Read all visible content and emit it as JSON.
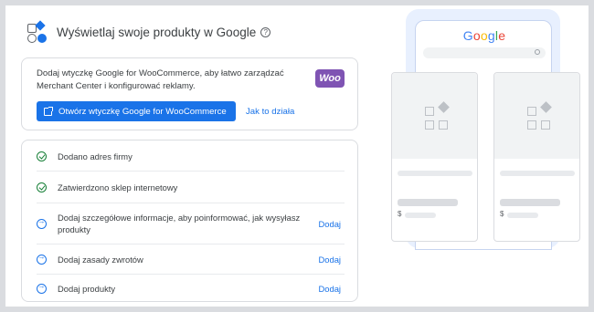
{
  "header": {
    "title": "Wyświetlaj swoje produkty w Google",
    "help_glyph": "?"
  },
  "plugin_card": {
    "description": "Dodaj wtyczkę Google for WooCommerce, aby łatwo zarządzać Merchant Center i konfigurować reklamy.",
    "logo_text": "Woo",
    "primary_button": "Otwórz wtyczkę Google for WooCommerce",
    "secondary_link": "Jak to działa"
  },
  "checklist": [
    {
      "status": "done",
      "label": "Dodano adres firmy",
      "action": ""
    },
    {
      "status": "done",
      "label": "Zatwierdzono sklep internetowy",
      "action": ""
    },
    {
      "status": "todo",
      "label": "Dodaj szczegółowe informacje, aby poinformować, jak wysyłasz produkty",
      "action": "Dodaj"
    },
    {
      "status": "todo",
      "label": "Dodaj zasady zwrotów",
      "action": "Dodaj"
    },
    {
      "status": "todo",
      "label": "Dodaj produkty",
      "action": "Dodaj"
    }
  ],
  "illustration": {
    "google_letters": [
      "G",
      "o",
      "o",
      "g",
      "l",
      "e"
    ],
    "google_colors": [
      "#4285f4",
      "#ea4335",
      "#fbbc05",
      "#4285f4",
      "#34a853",
      "#ea4335"
    ],
    "currency_symbol": "$"
  },
  "colors": {
    "accent": "#1a73e8",
    "success": "#188038",
    "woo_brand": "#7f54b3"
  }
}
